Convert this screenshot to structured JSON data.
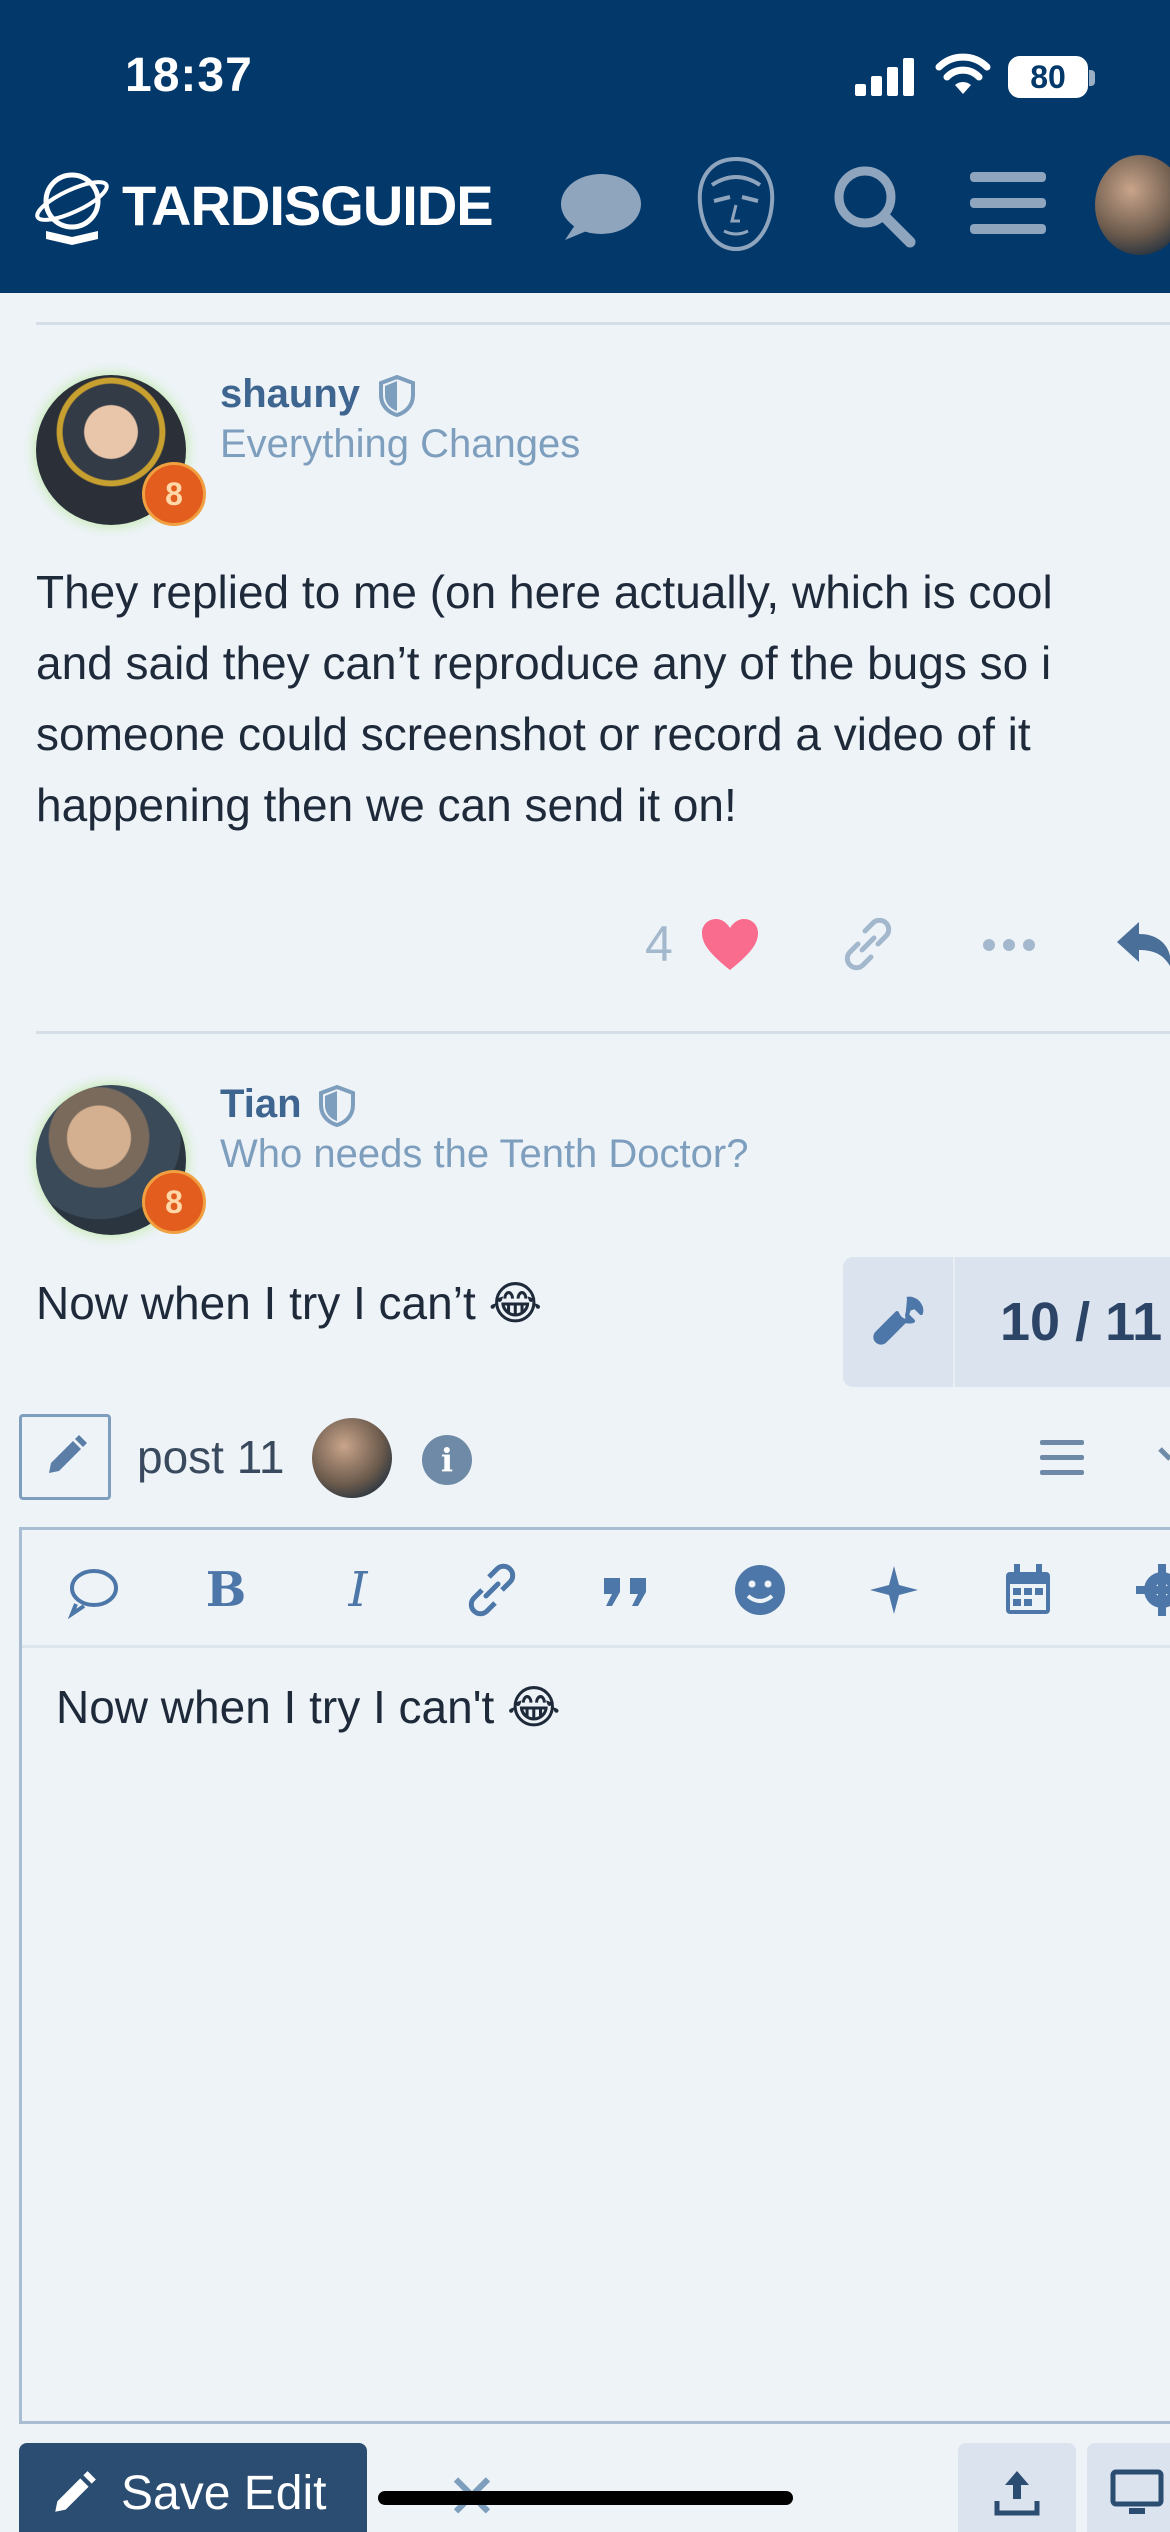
{
  "status_bar": {
    "time": "18:37",
    "battery": "80"
  },
  "header": {
    "brand": "TARDISGUIDE"
  },
  "posts": [
    {
      "username": "shauny",
      "user_title": "Everything Changes",
      "body_lines": [
        "They replied to me (on here actually, which is cool",
        "and said they can’t reproduce any of the bugs so i",
        "someone could screenshot or record a video of it",
        "happening then we can send it on!"
      ],
      "like_count": "4",
      "badge": "8"
    },
    {
      "username": "Tian",
      "user_title": "Who needs the Tenth Doctor?",
      "body_lines": [
        "Now when I try I can’t 😂"
      ],
      "badge": "8"
    }
  ],
  "progress": {
    "label": "10 / 11"
  },
  "composer": {
    "post_ref": "post 11",
    "content": "Now when I try I can't 😂",
    "save_label": "Save Edit",
    "cancel_symbol": "✕"
  },
  "colors": {
    "header_bg": "#03386b",
    "accent": "#3e6590",
    "like": "#fa6c8d"
  }
}
